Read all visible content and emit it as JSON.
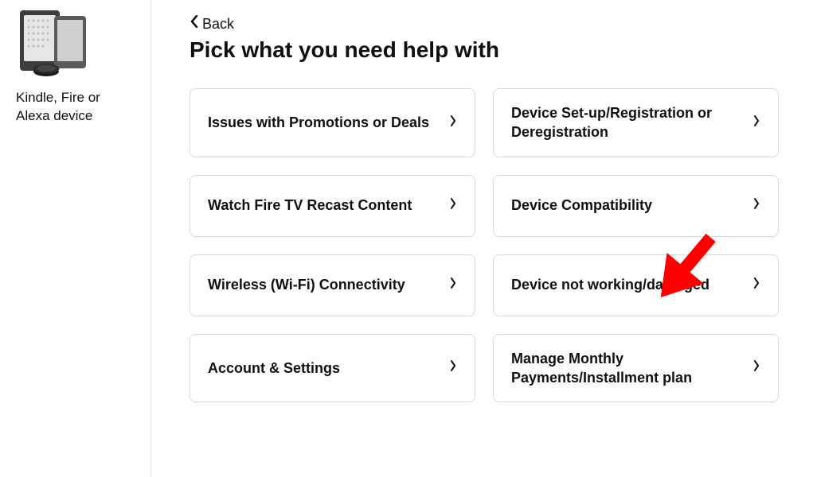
{
  "sidebar": {
    "caption": "Kindle, Fire or Alexa device"
  },
  "back_label": "Back",
  "page_title": "Pick what you need help with",
  "options": [
    {
      "label": "Issues with Promotions or Deals"
    },
    {
      "label": "Device Set-up/Registration or Deregistration"
    },
    {
      "label": "Watch Fire TV Recast Content"
    },
    {
      "label": "Device Compatibility"
    },
    {
      "label": "Wireless (Wi-Fi) Connectivity"
    },
    {
      "label": "Device not working/damaged"
    },
    {
      "label": "Account & Settings"
    },
    {
      "label": "Manage Monthly Payments/Installment plan"
    }
  ]
}
